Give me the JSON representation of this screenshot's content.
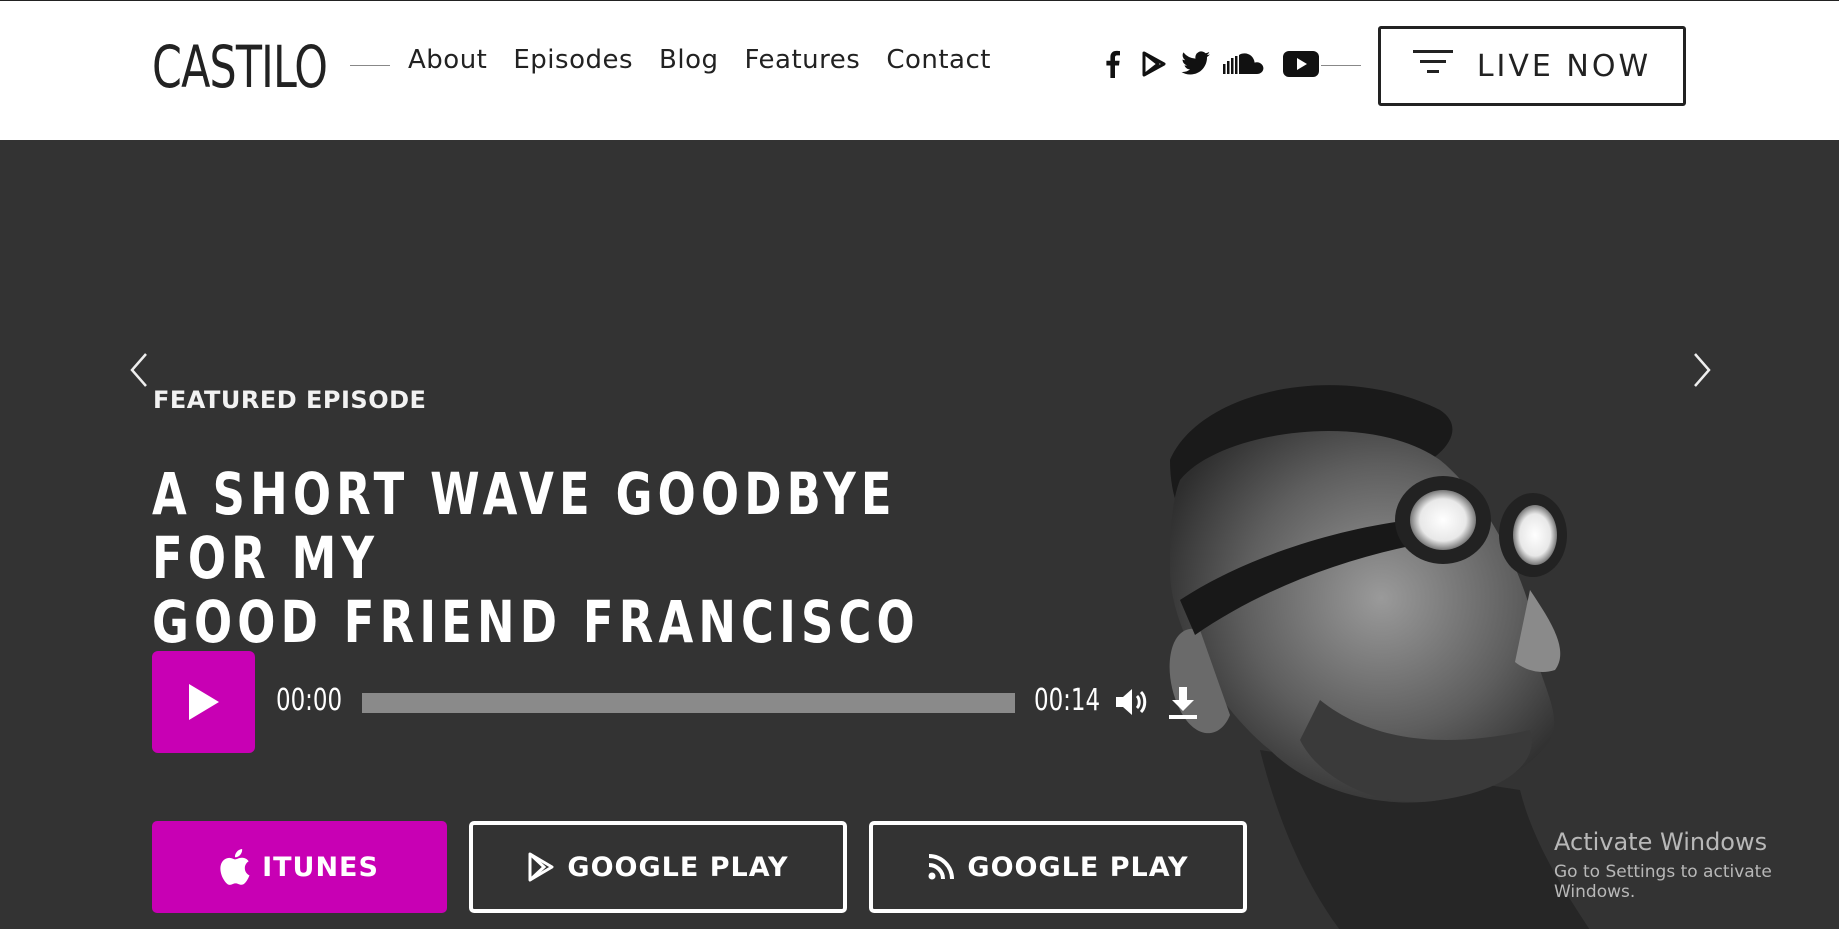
{
  "brand": {
    "logo": "CASTILO"
  },
  "nav": {
    "items": [
      {
        "label": "About"
      },
      {
        "label": "Episodes"
      },
      {
        "label": "Blog"
      },
      {
        "label": "Features"
      },
      {
        "label": "Contact"
      }
    ]
  },
  "social": [
    "facebook-icon",
    "google-play-icon",
    "twitter-icon",
    "soundcloud-icon",
    "youtube-icon"
  ],
  "header": {
    "live_label": "LIVE NOW"
  },
  "hero": {
    "eyebrow": "FEATURED EPISODE",
    "title_line1": "A SHORT WAVE GOODBYE FOR MY",
    "title_line2": "GOOD FRIEND FRANCISCO"
  },
  "player": {
    "current_time": "00:00",
    "duration": "00:14",
    "progress_fraction": 0
  },
  "stores": {
    "itunes_label": "ITUNES",
    "google_play_label": "GOOGLE PLAY",
    "rss_label": "GOOGLE PLAY"
  },
  "watermark": {
    "title": "Activate Windows",
    "subtitle": "Go to Settings to activate Windows."
  },
  "colors": {
    "accent": "#c800b4",
    "hero_bg": "#333333",
    "header_bg": "#ffffff",
    "progress_track": "#8a8a8a"
  }
}
